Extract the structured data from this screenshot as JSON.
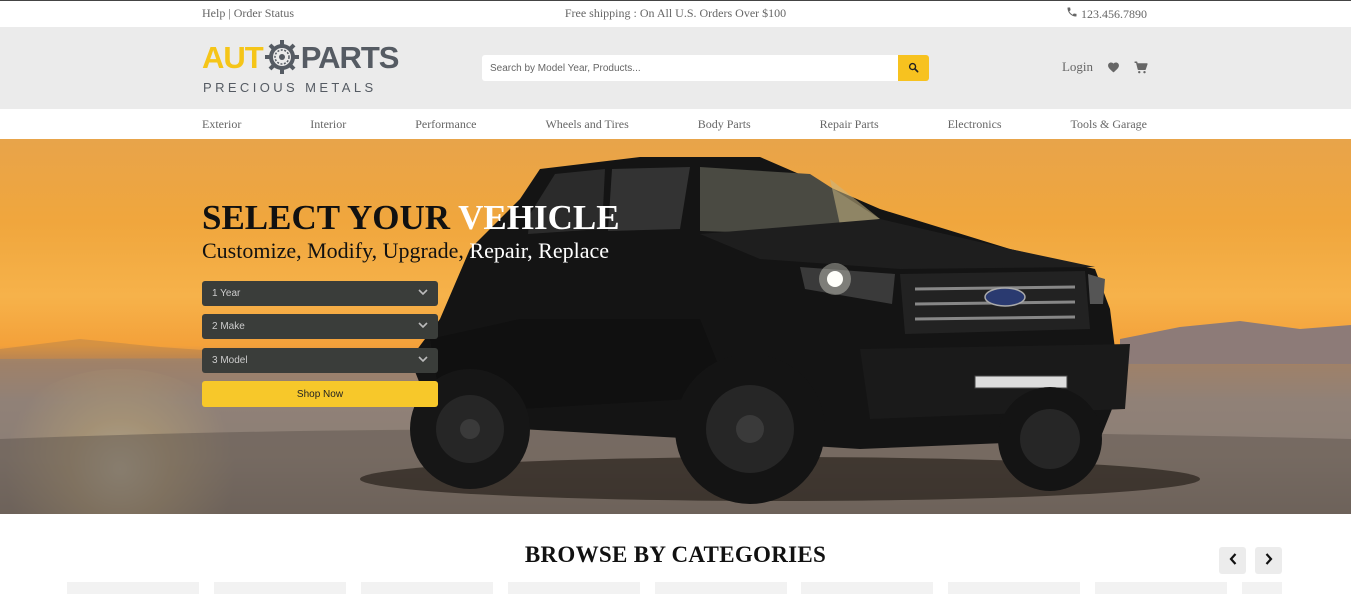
{
  "topbar": {
    "help": "Help",
    "separator": "|",
    "order_status": "Order Status",
    "shipping": "Free shipping : On All U.S. Orders Over $100",
    "phone": "123.456.7890",
    "phone_icon": "phone-icon"
  },
  "logo": {
    "aut": "AUT",
    "parts": "PARTS",
    "tagline": "PRECIOUS METALS",
    "gear_icon": "gear-icon"
  },
  "search": {
    "placeholder": "Search by Model Year, Products...",
    "button_icon": "search-icon"
  },
  "header_actions": {
    "login": "Login",
    "wishlist_icon": "heart-icon",
    "cart_icon": "cart-icon"
  },
  "nav": {
    "items": [
      "Exterior",
      "Interior",
      "Performance",
      "Wheels and Tires",
      "Body Parts",
      "Repair Parts",
      "Electronics",
      "Tools & Garage"
    ]
  },
  "hero": {
    "title_dark": "SELECT YOUR ",
    "title_light": "VEHICLE",
    "subtitle_dark": "Customize, Modify, Upgrade, ",
    "subtitle_light": "Repair, Replace",
    "year_select": "1 Year",
    "make_select": "2 Make",
    "model_select": "3 Model",
    "shop_button": "Shop Now"
  },
  "browse": {
    "title": "BROWSE BY CATEGORIES",
    "prev_icon": "chevron-left-icon",
    "next_icon": "chevron-right-icon"
  },
  "colors": {
    "accent": "#f7c21f",
    "header_bg": "#ebebeb",
    "select_bg": "#3a3d3a"
  }
}
